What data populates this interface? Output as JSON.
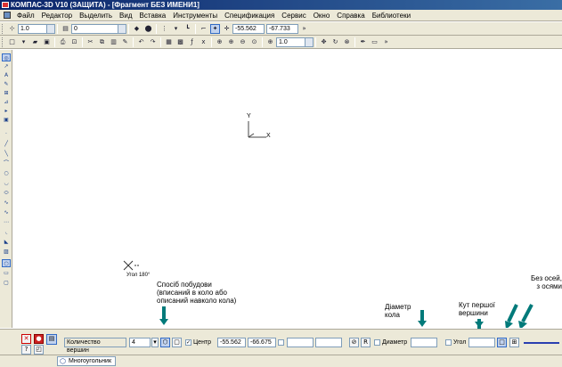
{
  "window": {
    "title": "КОМПАС-3D V10 (ЗАЩИТА) - [Фрагмент БЕЗ ИМЕНИ1]"
  },
  "menu": [
    "Файл",
    "Редактор",
    "Выделить",
    "Вид",
    "Вставка",
    "Инструменты",
    "Спецификация",
    "Сервис",
    "Окно",
    "Справка",
    "Библиотеки"
  ],
  "toolbar1": {
    "scale": "1.0",
    "layer": "0",
    "coord_x": "-55.562",
    "coord_y": "-67.733"
  },
  "toolbar2": {
    "zoom": "1.0"
  },
  "canvas": {
    "axis_y": "Y",
    "axis_x": "X",
    "angle_label": "Угол 180°"
  },
  "annotations": {
    "method": "Спосіб побудови\n(вписаний в коло або\nописаний навколо кола)",
    "diameter": "Діаметр\nкола",
    "vertex_angle": "Кут першої\nвершини",
    "axes": "Без осей,\nз осями"
  },
  "propbar": {
    "vertices_label": "Количество вершин",
    "vertices_value": "4",
    "center_label": "Центр",
    "center_x": "-55.562",
    "center_y": "-66.675",
    "r_label": "R",
    "diameter_label": "Диаметр",
    "angle_label": "Угол"
  },
  "tabs": [
    "Многоугольник"
  ],
  "colors": {
    "accent": "#007a7a",
    "titlebar": "#0a246a",
    "panel": "#ece9d8"
  }
}
